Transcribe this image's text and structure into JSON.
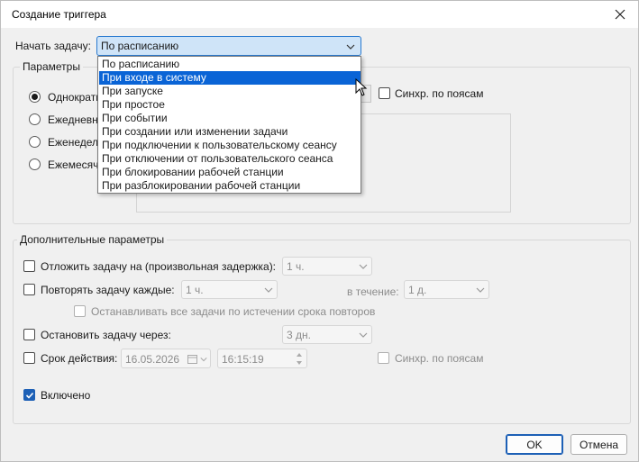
{
  "window": {
    "title": "Создание триггера"
  },
  "begin_task": {
    "label": "Начать задачу:",
    "value": "По расписанию",
    "options": [
      "По расписанию",
      "При входе в систему",
      "При запуске",
      "При простое",
      "При событии",
      "При создании или изменении задачи",
      "При подключении к пользовательскому сеансу",
      "При отключении от пользовательского сеанса",
      "При блокировании рабочей станции",
      "При разблокировании рабочей станции"
    ],
    "highlighted_index": 1
  },
  "params": {
    "title": "Параметры",
    "radios": [
      "Однократн",
      "Ежедневно",
      "Еженедель",
      "Ежемесяч"
    ],
    "selected_radio": 0,
    "sync_label": "Синхр. по поясам"
  },
  "advanced": {
    "title": "Дополнительные параметры",
    "delay_label": "Отложить задачу на (произвольная задержка):",
    "delay_value": "1 ч.",
    "repeat_label": "Повторять задачу каждые:",
    "repeat_value": "1 ч.",
    "duration_label": "в течение:",
    "duration_value": "1 д.",
    "stop_all_label": "Останавливать все задачи по истечении срока повторов",
    "stop_after_label": "Остановить задачу через:",
    "stop_after_value": "3 дн.",
    "expire_label": "Срок действия:",
    "expire_date": "16.05.2026",
    "expire_time": "16:15:19",
    "expire_sync_label": "Синхр. по поясам",
    "enabled_label": "Включено"
  },
  "buttons": {
    "ok": "OK",
    "cancel": "Отмена"
  },
  "colors": {
    "accent": "#0a64d6",
    "combo_focus": "#cfe4f8",
    "checked": "#1d60b6"
  }
}
